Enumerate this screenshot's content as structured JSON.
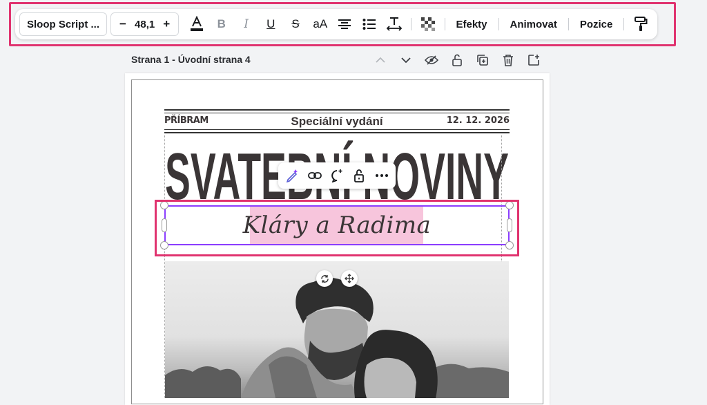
{
  "toolbar": {
    "font_name": "Sloop Script ...",
    "size_decrease": "−",
    "font_size": "48,1",
    "size_increase": "+",
    "case_label": "aA",
    "effects_label": "Efekty",
    "animate_label": "Animovat",
    "position_label": "Pozice"
  },
  "page": {
    "title": "Strana 1 - Úvodní strana 4"
  },
  "design": {
    "place": "PŘÍBRAM",
    "edition": "Speciální vydání",
    "date": "12. 12. 2026",
    "masthead": "SVATEBNÍ NOVINY",
    "subtitle": "Kláry a Radima"
  },
  "colors": {
    "accent": "#8b3dff",
    "highlight": "#e0336f",
    "selection": "#f7c5dc",
    "ink": "#3a3536"
  }
}
